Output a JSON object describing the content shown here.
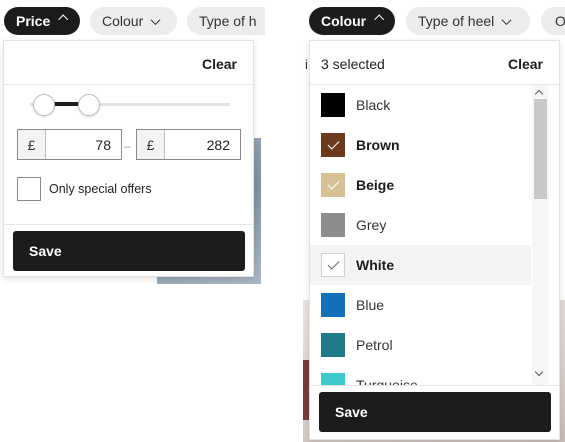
{
  "filters": {
    "left": [
      {
        "label": "Price",
        "active": true,
        "open": true
      },
      {
        "label": "Colour",
        "active": false
      },
      {
        "label": "Type of h",
        "active": false
      }
    ],
    "right": [
      {
        "label": "Colour",
        "active": true,
        "open": true
      },
      {
        "label": "Type of heel",
        "active": false
      },
      {
        "label": "O",
        "active": false
      }
    ]
  },
  "background": {
    "letter": "i"
  },
  "price_panel": {
    "clear_label": "Clear",
    "min_value": "78",
    "max_value": "282",
    "currency": "£",
    "separator": "–",
    "special_offers_label": "Only special offers",
    "special_offers_checked": false,
    "save_label": "Save"
  },
  "colour_panel": {
    "selected_text": "3 selected",
    "clear_label": "Clear",
    "save_label": "Save",
    "colours": [
      {
        "name": "Black",
        "hex": "#000000",
        "selected": false
      },
      {
        "name": "Brown",
        "hex": "#6b3a1b",
        "selected": true
      },
      {
        "name": "Beige",
        "hex": "#d6c194",
        "selected": true
      },
      {
        "name": "Grey",
        "hex": "#8c8c8c",
        "selected": false
      },
      {
        "name": "White",
        "hex": "#ffffff",
        "selected": true
      },
      {
        "name": "Blue",
        "hex": "#1571b7",
        "selected": false
      },
      {
        "name": "Petrol",
        "hex": "#1f7a8c",
        "selected": false
      },
      {
        "name": "Turquoise",
        "hex": "#3cc9cc",
        "selected": false
      }
    ]
  }
}
